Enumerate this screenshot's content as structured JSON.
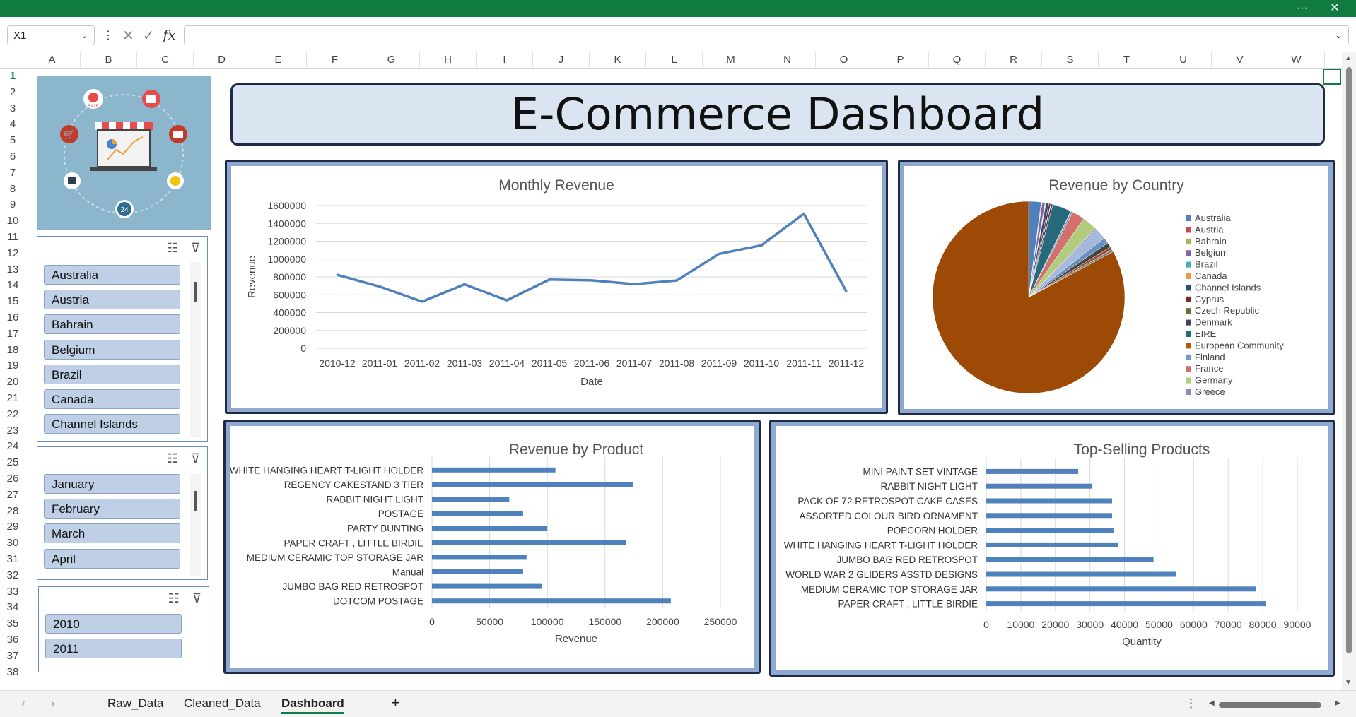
{
  "window": {
    "more_label": "···",
    "close_label": "✕"
  },
  "formula_bar": {
    "name_box": "X1",
    "cancel_icon": "✕",
    "enter_icon": "✓",
    "fx_label": "fx",
    "value": ""
  },
  "columns": [
    "A",
    "B",
    "C",
    "D",
    "E",
    "F",
    "G",
    "H",
    "I",
    "J",
    "K",
    "L",
    "M",
    "N",
    "O",
    "P",
    "Q",
    "R",
    "S",
    "T",
    "U",
    "V",
    "W"
  ],
  "rows": [
    "1",
    "2",
    "3",
    "4",
    "5",
    "6",
    "7",
    "8",
    "9",
    "10",
    "11",
    "12",
    "13",
    "14",
    "15",
    "16",
    "17",
    "18",
    "19",
    "20",
    "21",
    "22",
    "23",
    "24",
    "25",
    "26",
    "27",
    "28",
    "29",
    "30",
    "31",
    "32",
    "33",
    "34",
    "35",
    "36",
    "37",
    "38"
  ],
  "dashboard": {
    "title": "E-Commerce Dashboard"
  },
  "hero": {
    "sale_badge": "SALE",
    "hours_badge": "24"
  },
  "slicers": {
    "country": {
      "items": [
        "Australia",
        "Austria",
        "Bahrain",
        "Belgium",
        "Brazil",
        "Canada",
        "Channel Islands"
      ]
    },
    "month": {
      "items": [
        "January",
        "February",
        "March",
        "April"
      ]
    },
    "year": {
      "items": [
        "2010",
        "2011"
      ]
    }
  },
  "colors": {
    "accent": "#107c41",
    "line": "#4f81bd",
    "panel_border": "#1e2a47",
    "panel_fill": "#8fa8cf",
    "title_fill": "#dbe5f1"
  },
  "chart_data": [
    {
      "type": "line",
      "title": "Monthly Revenue",
      "xlabel": "Date",
      "ylabel": "Revenue",
      "ylim": [
        0,
        1600000
      ],
      "yticks": [
        "1600000",
        "1400000",
        "1200000",
        "1000000",
        "800000",
        "600000",
        "400000",
        "200000",
        "0"
      ],
      "x": [
        "2010-12",
        "2011-01",
        "2011-02",
        "2011-03",
        "2011-04",
        "2011-05",
        "2011-06",
        "2011-07",
        "2011-08",
        "2011-09",
        "2011-10",
        "2011-11",
        "2011-12"
      ],
      "values": [
        823000,
        692000,
        523000,
        717000,
        538000,
        770000,
        761000,
        719000,
        759000,
        1058000,
        1154000,
        1509000,
        638000
      ],
      "grid": true
    },
    {
      "type": "pie",
      "title": "Revenue by Country",
      "legend": "right",
      "labels": [
        "Australia",
        "Austria",
        "Bahrain",
        "Belgium",
        "Brazil",
        "Canada",
        "Channel Islands",
        "Cyprus",
        "Czech Republic",
        "Denmark",
        "EIRE",
        "European Community",
        "Finland",
        "France",
        "Germany",
        "Greece"
      ],
      "colors": [
        "#4f81bd",
        "#c0504d",
        "#9bbb59",
        "#8064a2",
        "#4bacc6",
        "#f79646",
        "#2c4d75",
        "#772c2a",
        "#5f7530",
        "#4d3b62",
        "#276a7c",
        "#b65708",
        "#729aca",
        "#d4706c",
        "#b1cc7c",
        "#9d86b7"
      ],
      "values": [
        2.1,
        0.1,
        0.05,
        0.5,
        0.05,
        0.1,
        0.5,
        0.3,
        0.05,
        0.3,
        3.2,
        0.05,
        0.3,
        2.1,
        2.5,
        0.2,
        2.0,
        1.0,
        0.8,
        0.5,
        0.4,
        82.9
      ],
      "extra_colors": [
        "#a5b9dc",
        "#6b8fc0",
        "#444444",
        "#9b4f2b",
        "#7f7f7f",
        "#a0420f"
      ]
    },
    {
      "type": "bar",
      "orientation": "horizontal",
      "title": "Revenue by Product",
      "xlabel": "Revenue",
      "xlim": [
        0,
        250000
      ],
      "xticks": [
        "0",
        "50000",
        "100000",
        "150000",
        "200000",
        "250000"
      ],
      "categories": [
        "WHITE HANGING HEART T-LIGHT HOLDER",
        "REGENCY CAKESTAND 3 TIER",
        "RABBIT NIGHT LIGHT",
        "POSTAGE",
        "PARTY BUNTING",
        "PAPER CRAFT , LITTLE BIRDIE",
        "MEDIUM CERAMIC TOP STORAGE JAR",
        "Manual",
        "JUMBO BAG RED RETROSPOT",
        "DOTCOM POSTAGE"
      ],
      "values": [
        107000,
        174000,
        67000,
        79000,
        100000,
        168000,
        82000,
        79000,
        95000,
        207000
      ],
      "grid": true
    },
    {
      "type": "bar",
      "orientation": "horizontal",
      "title": "Top-Selling Products",
      "xlabel": "Quantity",
      "xlim": [
        0,
        90000
      ],
      "xticks": [
        "0",
        "10000",
        "20000",
        "30000",
        "40000",
        "50000",
        "60000",
        "70000",
        "80000",
        "90000"
      ],
      "categories": [
        "MINI PAINT SET VINTAGE",
        "RABBIT NIGHT LIGHT",
        "PACK OF 72 RETROSPOT CAKE CASES",
        "ASSORTED COLOUR BIRD ORNAMENT",
        "POPCORN HOLDER",
        "WHITE HANGING HEART T-LIGHT HOLDER",
        "JUMBO BAG RED RETROSPOT",
        "WORLD WAR 2 GLIDERS ASSTD DESIGNS",
        "MEDIUM CERAMIC TOP STORAGE JAR",
        "PAPER CRAFT , LITTLE BIRDIE"
      ],
      "values": [
        26600,
        30700,
        36400,
        36400,
        36800,
        38100,
        48400,
        55000,
        78000,
        81000
      ],
      "grid": true
    }
  ],
  "sheet_tabs": [
    "Raw_Data",
    "Cleaned_Data",
    "Dashboard"
  ],
  "active_tab": "Dashboard",
  "add_sheet_label": "+"
}
